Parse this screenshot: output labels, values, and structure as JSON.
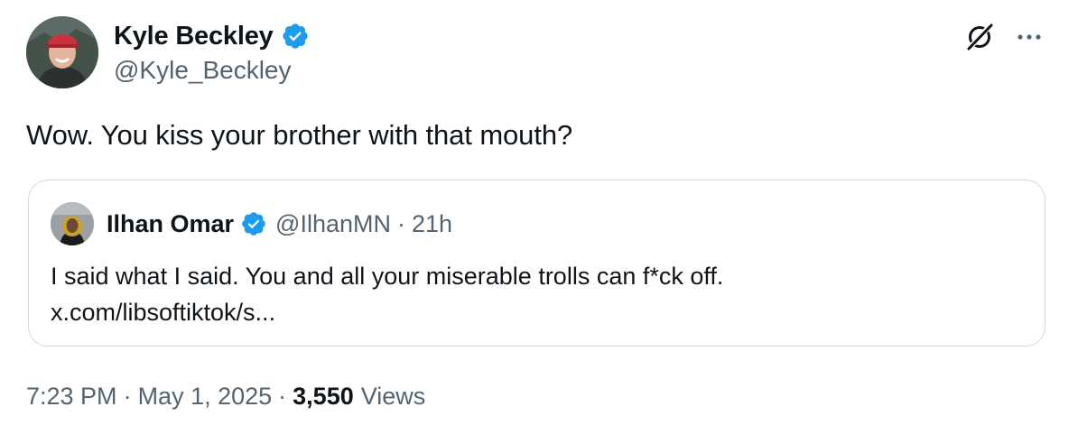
{
  "author": {
    "display_name": "Kyle Beckley",
    "handle": "@Kyle_Beckley",
    "verified": true
  },
  "actions": {
    "grok_icon": "grok-icon",
    "more_icon": "more-icon"
  },
  "tweet": {
    "text": "Wow. You kiss your brother with that mouth?"
  },
  "quoted_tweet": {
    "display_name": "Ilhan Omar",
    "handle": "@IlhanMN",
    "separator": "·",
    "time": "21h",
    "text": "I said what I said. You and all your miserable trolls can f*ck off.",
    "link": "x.com/libsoftiktok/s..."
  },
  "meta": {
    "time": "7:23 PM",
    "separator": "·",
    "date": "May 1, 2025",
    "views_count": "3,550",
    "views_label": "Views"
  },
  "colors": {
    "primary_text": "#0f1419",
    "secondary_text": "#536471",
    "verified_blue": "#1d9bf0",
    "border": "#cfd9de"
  }
}
